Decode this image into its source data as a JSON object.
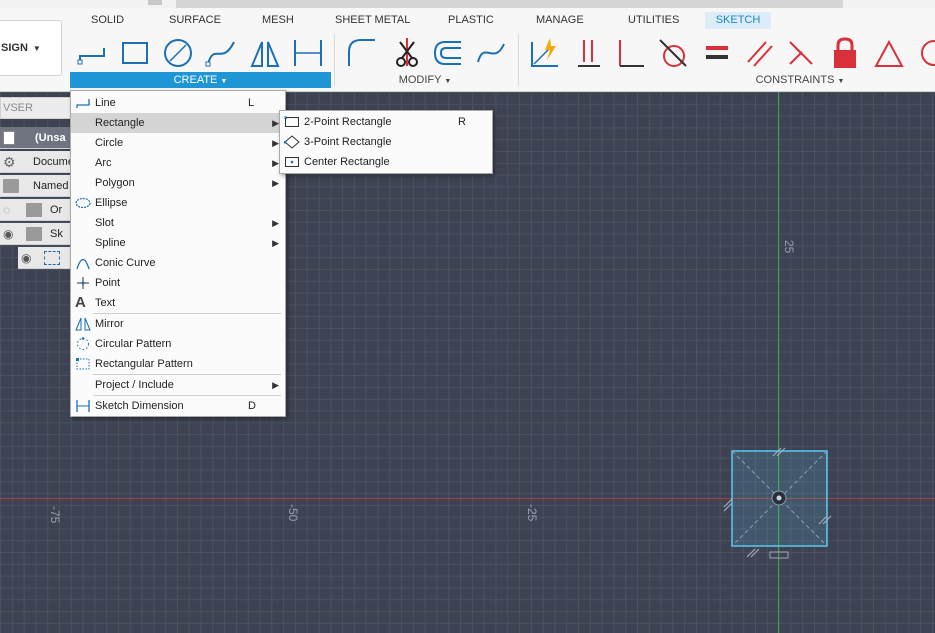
{
  "tabs": [
    "SOLID",
    "SURFACE",
    "MESH",
    "SHEET METAL",
    "PLASTIC",
    "MANAGE",
    "UTILITIES",
    "SKETCH"
  ],
  "active_tab": "SKETCH",
  "workspace_label": "SIGN",
  "groups": {
    "create": "CREATE",
    "modify": "MODIFY",
    "constraints": "CONSTRAINTS"
  },
  "browser": {
    "header": "VSER",
    "rows": [
      "(Unsa",
      "Docume",
      "Named V",
      "Or",
      "Sk",
      ""
    ]
  },
  "axis_labels": {
    "x_neg75": "-75",
    "x_neg50": "-50",
    "x_neg25": "-25",
    "y_25": "25"
  },
  "create_menu": {
    "items": [
      {
        "label": "Line",
        "shortcut": "L",
        "icon": "line-icon"
      },
      {
        "label": "Rectangle",
        "submenu": true,
        "icon": "none"
      },
      {
        "label": "Circle",
        "submenu": true,
        "icon": "none"
      },
      {
        "label": "Arc",
        "submenu": true,
        "icon": "none"
      },
      {
        "label": "Polygon",
        "submenu": true,
        "icon": "none"
      },
      {
        "label": "Ellipse",
        "icon": "ellipse-icon"
      },
      {
        "label": "Slot",
        "submenu": true,
        "icon": "none"
      },
      {
        "label": "Spline",
        "submenu": true,
        "icon": "none"
      },
      {
        "label": "Conic Curve",
        "icon": "conic-curve-icon"
      },
      {
        "label": "Point",
        "icon": "point-icon"
      },
      {
        "label": "Text",
        "icon": "text-icon"
      },
      {
        "label": "Mirror",
        "icon": "mirror-icon"
      },
      {
        "label": "Circular Pattern",
        "icon": "circular-pattern-icon"
      },
      {
        "label": "Rectangular Pattern",
        "icon": "rectangular-pattern-icon"
      },
      {
        "label": "Project / Include",
        "submenu": true,
        "icon": "none"
      },
      {
        "label": "Sketch Dimension",
        "shortcut": "D",
        "icon": "sketch-dimension-icon"
      }
    ]
  },
  "rectangle_submenu": {
    "items": [
      {
        "label": "2-Point Rectangle",
        "shortcut": "R",
        "icon": "two-point-rectangle-icon"
      },
      {
        "label": "3-Point Rectangle",
        "icon": "three-point-rectangle-icon"
      },
      {
        "label": "Center Rectangle",
        "icon": "center-rectangle-icon"
      }
    ]
  },
  "colors": {
    "accent": "#1e95d4",
    "sketch_red": "#d9313a",
    "tool_blue": "#1b6fb5",
    "canvas": "#3d4352",
    "sketch_line": "#5bc8f5"
  }
}
